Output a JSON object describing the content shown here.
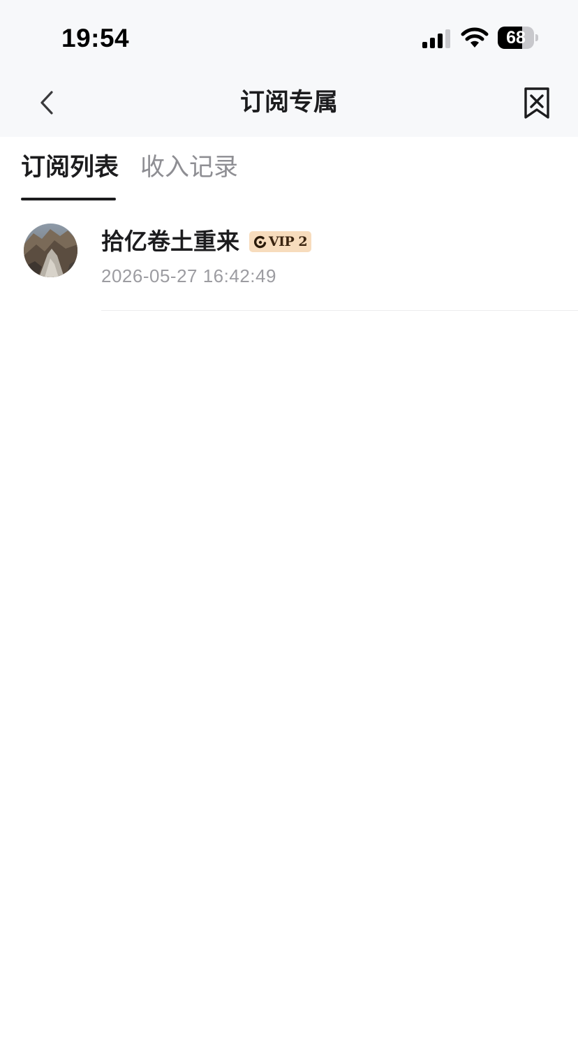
{
  "status_bar": {
    "time": "19:54",
    "battery_level": "68",
    "battery_fraction": 0.68
  },
  "nav": {
    "title": "订阅专属",
    "back_icon": "chevron-left-icon",
    "right_icon": "bookmark-x-icon"
  },
  "tabs": [
    {
      "label": "订阅列表",
      "active": true
    },
    {
      "label": "收入记录",
      "active": false
    }
  ],
  "subscriptions": [
    {
      "name": "拾亿卷土重来",
      "vip_label": "VIP 2",
      "timestamp": "2026-05-27 16:42:49"
    }
  ],
  "colors": {
    "header_bg": "#f7f8fa",
    "vip_badge_bg": "#f7dcbd",
    "muted_text": "#8e8e93"
  }
}
